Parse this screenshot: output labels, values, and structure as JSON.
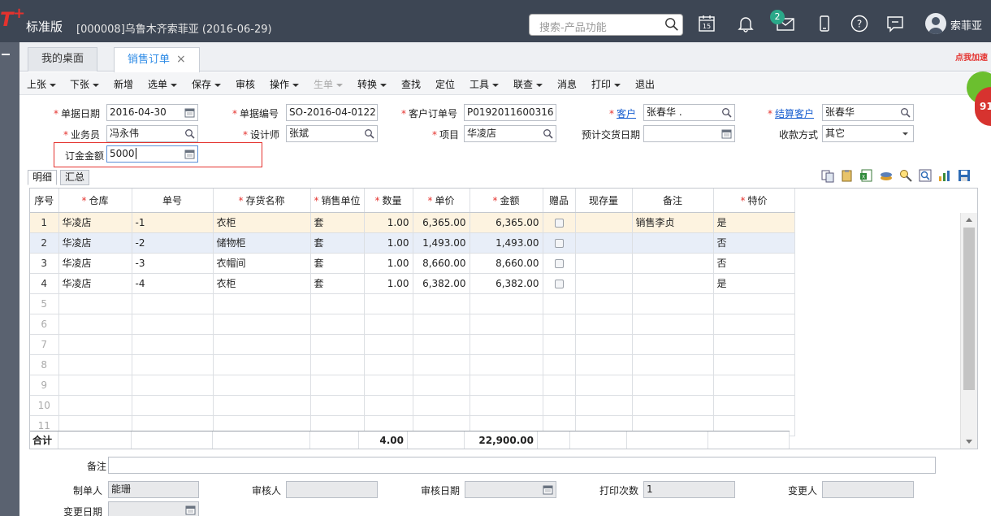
{
  "app": {
    "logo": "T",
    "logo_plus": "+",
    "edition": "标准版",
    "company": "[000008]乌鲁木齐索菲亚   (2016-06-29)",
    "search_placeholder": "搜索-产品功能",
    "calendar_day": "15",
    "mail_badge": "2",
    "username": "索菲亚"
  },
  "tabs": [
    {
      "label": "我的桌面"
    },
    {
      "label": "销售订单",
      "close": "×"
    }
  ],
  "toolbar": [
    {
      "label": "上张",
      "dropdown": true
    },
    {
      "label": "下张",
      "dropdown": true
    },
    {
      "label": "新增"
    },
    {
      "label": "选单",
      "dropdown": true
    },
    {
      "label": "保存",
      "dropdown": true
    },
    {
      "label": "审核"
    },
    {
      "label": "操作",
      "dropdown": true
    },
    {
      "label": "生单",
      "dropdown": true,
      "disabled": true
    },
    {
      "label": "转换",
      "dropdown": true
    },
    {
      "label": "查找"
    },
    {
      "label": "定位"
    },
    {
      "label": "工具",
      "dropdown": true
    },
    {
      "label": "联查",
      "dropdown": true
    },
    {
      "label": "消息"
    },
    {
      "label": "打印",
      "dropdown": true
    },
    {
      "label": "退出"
    }
  ],
  "form": {
    "doc_date": {
      "label": "单据日期",
      "value": "2016-04-30"
    },
    "doc_no": {
      "label": "单据编号",
      "value": "SO-2016-04-0122"
    },
    "cust_order_no": {
      "label": "客户订单号",
      "value": "P0192011600316"
    },
    "customer": {
      "label": "客户",
      "value": "张春华 ."
    },
    "settle_customer": {
      "label": "结算客户",
      "value": "张春华"
    },
    "salesman": {
      "label": "业务员",
      "value": "冯永伟"
    },
    "designer": {
      "label": "设计师",
      "value": "张斌"
    },
    "project": {
      "label": "项目",
      "value": "华凌店"
    },
    "expected_delivery": {
      "label": "预计交货日期",
      "value": ""
    },
    "payment_method": {
      "label": "收款方式",
      "value": "其它"
    },
    "deposit": {
      "label": "订金金额",
      "value": "5000"
    }
  },
  "grid_tabs": [
    {
      "label": "明细"
    },
    {
      "label": "汇总"
    }
  ],
  "grid": {
    "columns": [
      {
        "label": "序号",
        "required": false
      },
      {
        "label": "仓库",
        "required": true
      },
      {
        "label": "单号",
        "required": false
      },
      {
        "label": "存货名称",
        "required": true
      },
      {
        "label": "销售单位",
        "required": true
      },
      {
        "label": "数量",
        "required": true
      },
      {
        "label": "单价",
        "required": true
      },
      {
        "label": "金额",
        "required": true
      },
      {
        "label": "赠品",
        "required": false
      },
      {
        "label": "现存量",
        "required": false
      },
      {
        "label": "备注",
        "required": false
      },
      {
        "label": "特价",
        "required": true
      }
    ],
    "rows": [
      {
        "idx": "1",
        "warehouse": "华凌店",
        "no": "-1",
        "item": "衣柜",
        "unit": "套",
        "qty": "1.00",
        "price": "6,365.00",
        "amount": "6,365.00",
        "stock": "",
        "remark": "销售李贞",
        "special": "是"
      },
      {
        "idx": "2",
        "warehouse": "华凌店",
        "no": "-2",
        "item": "储物柜",
        "unit": "套",
        "qty": "1.00",
        "price": "1,493.00",
        "amount": "1,493.00",
        "stock": "",
        "remark": "",
        "special": "否"
      },
      {
        "idx": "3",
        "warehouse": "华凌店",
        "no": "-3",
        "item": "衣帽间",
        "unit": "套",
        "qty": "1.00",
        "price": "8,660.00",
        "amount": "8,660.00",
        "stock": "",
        "remark": "",
        "special": "否"
      },
      {
        "idx": "4",
        "warehouse": "华凌店",
        "no": "-4",
        "item": "衣柜",
        "unit": "套",
        "qty": "1.00",
        "price": "6,382.00",
        "amount": "6,382.00",
        "stock": "",
        "remark": "",
        "special": "是"
      }
    ],
    "empty_rows": [
      "5",
      "6",
      "7",
      "8",
      "9",
      "10",
      "11"
    ],
    "total": {
      "label": "合计",
      "qty": "4.00",
      "amount": "22,900.00"
    }
  },
  "footer": {
    "remark": {
      "label": "备注",
      "value": ""
    },
    "creator": {
      "label": "制单人",
      "value": "能珊"
    },
    "auditor": {
      "label": "审核人",
      "value": ""
    },
    "audit_date": {
      "label": "审核日期",
      "value": ""
    },
    "print_count": {
      "label": "打印次数",
      "value": "1"
    },
    "modifier": {
      "label": "变更人",
      "value": ""
    },
    "modify_date": {
      "label": "变更日期",
      "value": ""
    }
  },
  "promo": {
    "text": "点我加速",
    "percent": "91"
  },
  "colors": {
    "topbar": "#3d4654",
    "accent": "#2e8be6",
    "required": "#e4322e",
    "selected_row": "#fdf3e0"
  }
}
